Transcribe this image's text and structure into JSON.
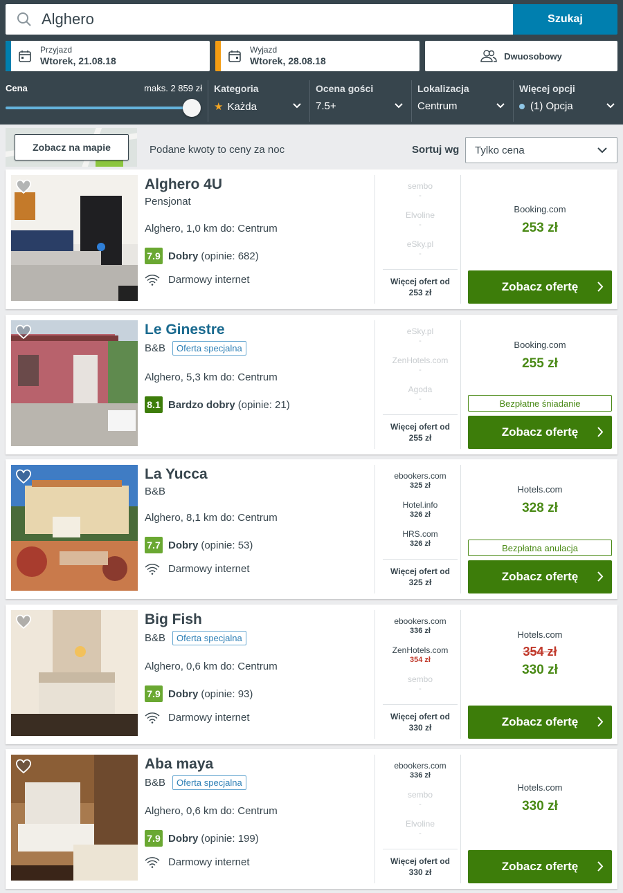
{
  "search": {
    "value": "Alghero",
    "button": "Szukaj"
  },
  "dates": {
    "checkin": {
      "label": "Przyjazd",
      "value": "Wtorek, 21.08.18",
      "color": "#007faf"
    },
    "checkout": {
      "label": "Wyjazd",
      "value": "Wtorek, 28.08.18",
      "color": "#f39c12"
    },
    "room": "Dwuosobowy"
  },
  "filters": {
    "price": {
      "label": "Cena",
      "max": "maks. 2 859 zł"
    },
    "category": {
      "label": "Kategoria",
      "value": "Każda"
    },
    "rating": {
      "label": "Ocena gości",
      "value": "7.5+"
    },
    "location": {
      "label": "Lokalizacja",
      "value": "Centrum"
    },
    "more": {
      "label": "Więcej opcji",
      "value": "(1) Opcja"
    }
  },
  "toolbar": {
    "map_button": "Zobacz na mapie",
    "price_note": "Podane kwoty to ceny za noc",
    "sort_label": "Sortuj wg",
    "sort_value": "Tylko cena"
  },
  "hotels": [
    {
      "name": "Alghero 4U",
      "type": "Pensjonat",
      "special": "",
      "location": "Alghero, 1,0 km do: Centrum",
      "score": "7.9",
      "score_color": "#6aa832",
      "rating_word": "Dobry",
      "reviews": "(opinie: 682)",
      "amenity": "Darmowy internet",
      "partners": [
        {
          "name": "sembo",
          "price": "-",
          "faded": true
        },
        {
          "name": "Elvoline",
          "price": "-",
          "faded": true
        },
        {
          "name": "eSky.pl",
          "price": "-",
          "faded": true
        }
      ],
      "more_label": "Więcej ofert od",
      "more_price": "253 zł",
      "best_site": "Booking.com",
      "best_price": "253 zł",
      "old_price": "",
      "perk": "",
      "button": "Zobacz ofertę"
    },
    {
      "name": "Le Ginestre",
      "type": "B&B",
      "special": "Oferta specjalna",
      "location": "Alghero, 5,3 km do: Centrum",
      "score": "8.1",
      "score_color": "#3d7d0a",
      "rating_word": "Bardzo dobry",
      "reviews": "(opinie: 21)",
      "amenity": "",
      "partners": [
        {
          "name": "eSky.pl",
          "price": "-",
          "faded": true
        },
        {
          "name": "ZenHotels.com",
          "price": "-",
          "faded": true
        },
        {
          "name": "Agoda",
          "price": "-",
          "faded": true
        }
      ],
      "more_label": "Więcej ofert od",
      "more_price": "255 zł",
      "best_site": "Booking.com",
      "best_price": "255 zł",
      "old_price": "",
      "perk": "Bezpłatne śniadanie",
      "button": "Zobacz ofertę"
    },
    {
      "name": "La Yucca",
      "type": "B&B",
      "special": "",
      "location": "Alghero, 8,1 km do: Centrum",
      "score": "7.7",
      "score_color": "#6aa832",
      "rating_word": "Dobry",
      "reviews": "(opinie: 53)",
      "amenity": "Darmowy internet",
      "partners": [
        {
          "name": "ebookers.com",
          "price": "325 zł",
          "faded": false
        },
        {
          "name": "Hotel.info",
          "price": "326 zł",
          "faded": false
        },
        {
          "name": "HRS.com",
          "price": "326 zł",
          "faded": false
        }
      ],
      "more_label": "Więcej ofert od",
      "more_price": "325 zł",
      "best_site": "Hotels.com",
      "best_price": "328 zł",
      "old_price": "",
      "perk": "Bezpłatna anulacja",
      "button": "Zobacz ofertę"
    },
    {
      "name": "Big Fish",
      "type": "B&B",
      "special": "Oferta specjalna",
      "location": "Alghero, 0,6 km do: Centrum",
      "score": "7.9",
      "score_color": "#6aa832",
      "rating_word": "Dobry",
      "reviews": "(opinie: 93)",
      "amenity": "Darmowy internet",
      "partners": [
        {
          "name": "ebookers.com",
          "price": "336 zł",
          "faded": false
        },
        {
          "name": "ZenHotels.com",
          "price": "354 zł",
          "faded": false,
          "red": true
        },
        {
          "name": "sembo",
          "price": "-",
          "faded": true
        }
      ],
      "more_label": "Więcej ofert od",
      "more_price": "330 zł",
      "best_site": "Hotels.com",
      "best_price": "330 zł",
      "old_price": "354 zł",
      "perk": "",
      "button": "Zobacz ofertę"
    },
    {
      "name": "Aba maya",
      "type": "B&B",
      "special": "Oferta specjalna",
      "location": "Alghero, 0,6 km do: Centrum",
      "score": "7.9",
      "score_color": "#6aa832",
      "rating_word": "Dobry",
      "reviews": "(opinie: 199)",
      "amenity": "Darmowy internet",
      "partners": [
        {
          "name": "ebookers.com",
          "price": "336 zł",
          "faded": false
        },
        {
          "name": "sembo",
          "price": "-",
          "faded": true
        },
        {
          "name": "Elvoline",
          "price": "-",
          "faded": true
        }
      ],
      "more_label": "Więcej ofert od",
      "more_price": "330 zł",
      "best_site": "Hotels.com",
      "best_price": "330 zł",
      "old_price": "",
      "perk": "",
      "button": "Zobacz ofertę"
    }
  ]
}
